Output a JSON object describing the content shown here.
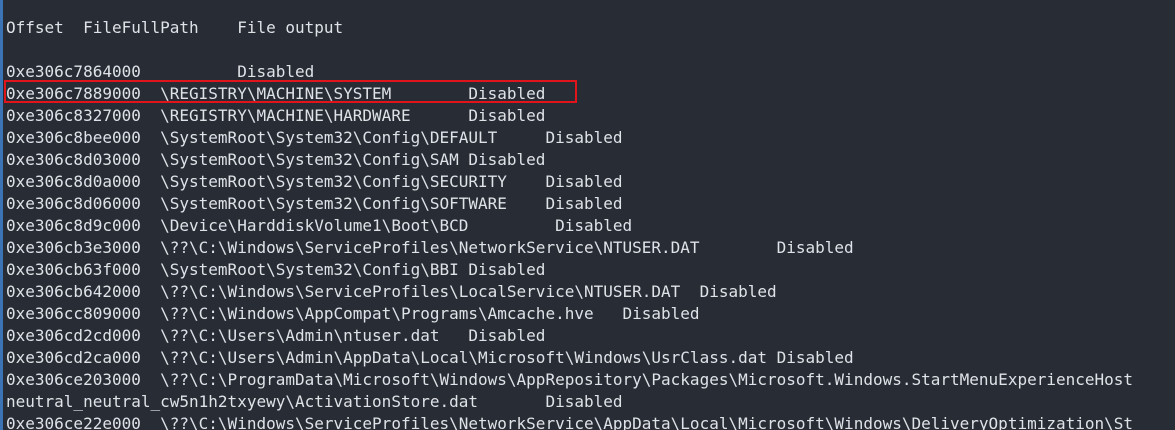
{
  "terminal": {
    "header": "Offset  FileFullPath    File output",
    "lines": [
      "0xe306c7864000          Disabled",
      "0xe306c7889000  \\REGISTRY\\MACHINE\\SYSTEM        Disabled",
      "0xe306c8327000  \\REGISTRY\\MACHINE\\HARDWARE      Disabled",
      "0xe306c8bee000  \\SystemRoot\\System32\\Config\\DEFAULT     Disabled",
      "0xe306c8d03000  \\SystemRoot\\System32\\Config\\SAM Disabled",
      "0xe306c8d0a000  \\SystemRoot\\System32\\Config\\SECURITY    Disabled",
      "0xe306c8d06000  \\SystemRoot\\System32\\Config\\SOFTWARE    Disabled",
      "0xe306c8d9c000  \\Device\\HarddiskVolume1\\Boot\\BCD         Disabled",
      "0xe306cb3e3000  \\??\\C:\\Windows\\ServiceProfiles\\NetworkService\\NTUSER.DAT        Disabled",
      "0xe306cb63f000  \\SystemRoot\\System32\\Config\\BBI Disabled",
      "0xe306cb642000  \\??\\C:\\Windows\\ServiceProfiles\\LocalService\\NTUSER.DAT  Disabled",
      "0xe306cc809000  \\??\\C:\\Windows\\AppCompat\\Programs\\Amcache.hve   Disabled",
      "0xe306cd2cd000  \\??\\C:\\Users\\Admin\\ntuser.dat   Disabled",
      "0xe306cd2ca000  \\??\\C:\\Users\\Admin\\AppData\\Local\\Microsoft\\Windows\\UsrClass.dat Disabled",
      "0xe306ce203000  \\??\\C:\\ProgramData\\Microsoft\\Windows\\AppRepository\\Packages\\Microsoft.Windows.StartMenuExperienceHost",
      "neutral_neutral_cw5n1h2txyewy\\ActivationStore.dat       Disabled",
      "0xe306ce22e000  \\??\\C:\\Windows\\ServiceProfiles\\NetworkService\\AppData\\Local\\Microsoft\\Windows\\DeliveryOptimization\\St"
    ]
  },
  "colors": {
    "background": "#282c34",
    "text": "#dfe2e7",
    "highlight_border": "#e0141a",
    "left_accent": "#3b73b5"
  }
}
